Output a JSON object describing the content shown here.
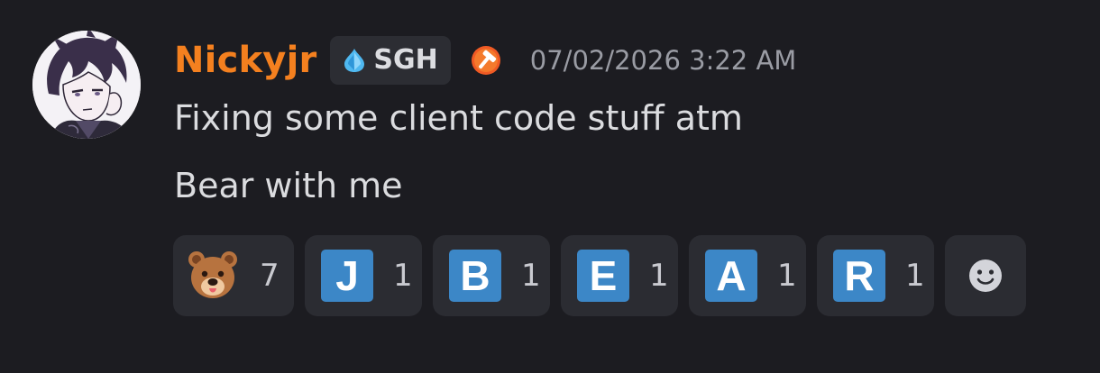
{
  "message": {
    "author": {
      "username": "Nickyjr",
      "username_color": "#f4801f",
      "avatar_icon": "anime-avatar",
      "tag": {
        "icon": "diamond-icon",
        "label": "SGH"
      },
      "role_icon": "hammer-icon"
    },
    "timestamp": "07/02/2026 3:22 AM",
    "lines": [
      "Fixing some client code stuff atm",
      "Bear with me"
    ]
  },
  "reactions": [
    {
      "emoji": "bear-face",
      "count": "7"
    },
    {
      "letter": "J",
      "count": "1"
    },
    {
      "letter": "B",
      "count": "1"
    },
    {
      "letter": "E",
      "count": "1"
    },
    {
      "letter": "A",
      "count": "1"
    },
    {
      "letter": "R",
      "count": "1"
    }
  ],
  "add_reaction": {
    "icon": "smiley-icon"
  },
  "colors": {
    "background": "#1c1c21",
    "reaction_bg": "#2b2c32",
    "letter_tile": "#3c87c7",
    "timestamp": "#9a9ca4"
  }
}
